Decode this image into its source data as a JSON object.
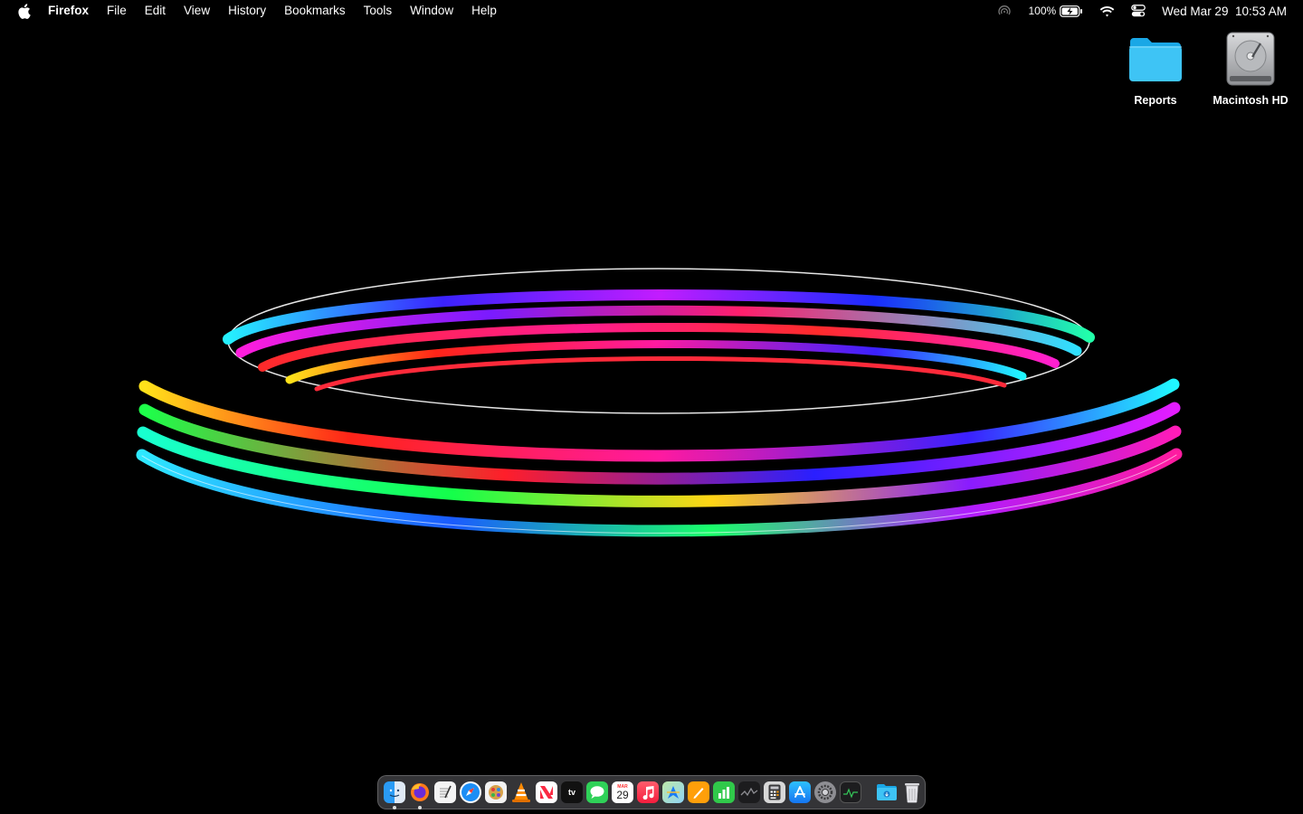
{
  "menubar": {
    "app_name": "Firefox",
    "menus": [
      "File",
      "Edit",
      "View",
      "History",
      "Bookmarks",
      "Tools",
      "Window",
      "Help"
    ],
    "battery_percent": "100%",
    "clock": "Wed Mar 29  10:53 AM"
  },
  "desktop_icons": {
    "reports": "Reports",
    "macintosh_hd": "Macintosh HD"
  },
  "dock": {
    "calendar_day": "29",
    "calendar_month": "MAR",
    "tv_label": "tv",
    "apps": [
      "Finder",
      "Firefox",
      "TextEdit",
      "Safari",
      "Photo Booth",
      "VLC",
      "News",
      "TV",
      "Messages",
      "Calendar",
      "Music",
      "Maps",
      "Pages",
      "Numbers",
      "Stocks",
      "Calculator",
      "App Store",
      "System Preferences",
      "Activity Monitor",
      "Downloads",
      "Trash"
    ]
  },
  "colors": {
    "folder_blue": "#3ec4f5",
    "dock_bg": "#48484c",
    "wallpaper_bg": "#000000"
  }
}
